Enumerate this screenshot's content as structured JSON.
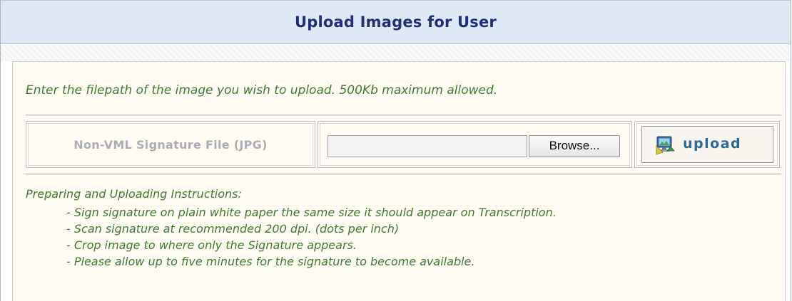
{
  "header": {
    "title": "Upload Images for User"
  },
  "form": {
    "instruction": "Enter the filepath of the image you wish to upload. 500Kb maximum allowed.",
    "field_label": "Non-VML Signature File (JPG)",
    "file_value": "",
    "browse_label": "Browse...",
    "upload_label": "upload",
    "upload_icon": "upload-icon"
  },
  "instructions": {
    "title": "Preparing and Uploading Instructions:",
    "steps": [
      "- Sign signature on plain white paper the same size it should appear on Transcription.",
      "- Scan signature at recommended 200 dpi. (dots per inch)",
      "- Crop image to where only the Signature appears.",
      "- Please allow up to five minutes for the signature to become available."
    ]
  },
  "colors": {
    "header_bg": "#dfe8f5",
    "header_text": "#1e2e7a",
    "panel_bg": "#fffbf2",
    "instruction_text": "#3b7d2c",
    "upload_text": "#2c6796",
    "label_text": "#a9adb5"
  }
}
